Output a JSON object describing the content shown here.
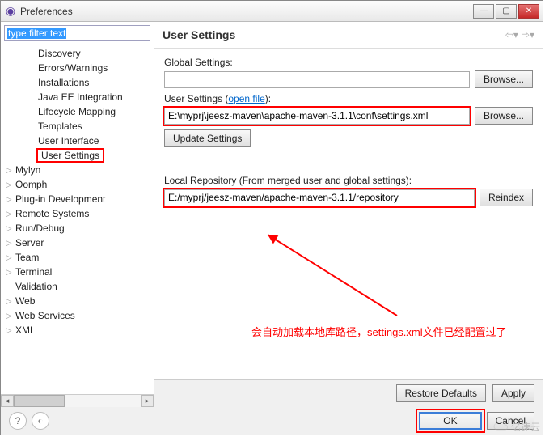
{
  "window": {
    "title": "Preferences"
  },
  "filter": {
    "text": "type filter text"
  },
  "tree": {
    "children": [
      "Discovery",
      "Errors/Warnings",
      "Installations",
      "Java EE Integration",
      "Lifecycle Mapping",
      "Templates",
      "User Interface",
      "User Settings"
    ],
    "top": [
      "Mylyn",
      "Oomph",
      "Plug-in Development",
      "Remote Systems",
      "Run/Debug",
      "Server",
      "Team",
      "Terminal",
      "Validation",
      "Web",
      "Web Services",
      "XML"
    ]
  },
  "page": {
    "title": "User Settings",
    "globalLabel": "Global Settings:",
    "globalValue": "",
    "userLabel": "User Settings",
    "openFile": "open file",
    "userValue": "E:\\myprj\\jeesz-maven\\apache-maven-3.1.1\\conf\\settings.xml",
    "updateBtn": "Update Settings",
    "browseBtn": "Browse...",
    "repoLabel": "Local Repository (From merged user and global settings):",
    "repoValue": "E:/myprj/jeesz-maven/apache-maven-3.1.1/repository",
    "reindexBtn": "Reindex",
    "restoreBtn": "Restore Defaults",
    "applyBtn": "Apply",
    "okBtn": "OK",
    "cancelBtn": "Cancel"
  },
  "annotation": "会自动加载本地库路径，settings.xml文件已经配置过了",
  "watermark": "亿速云"
}
